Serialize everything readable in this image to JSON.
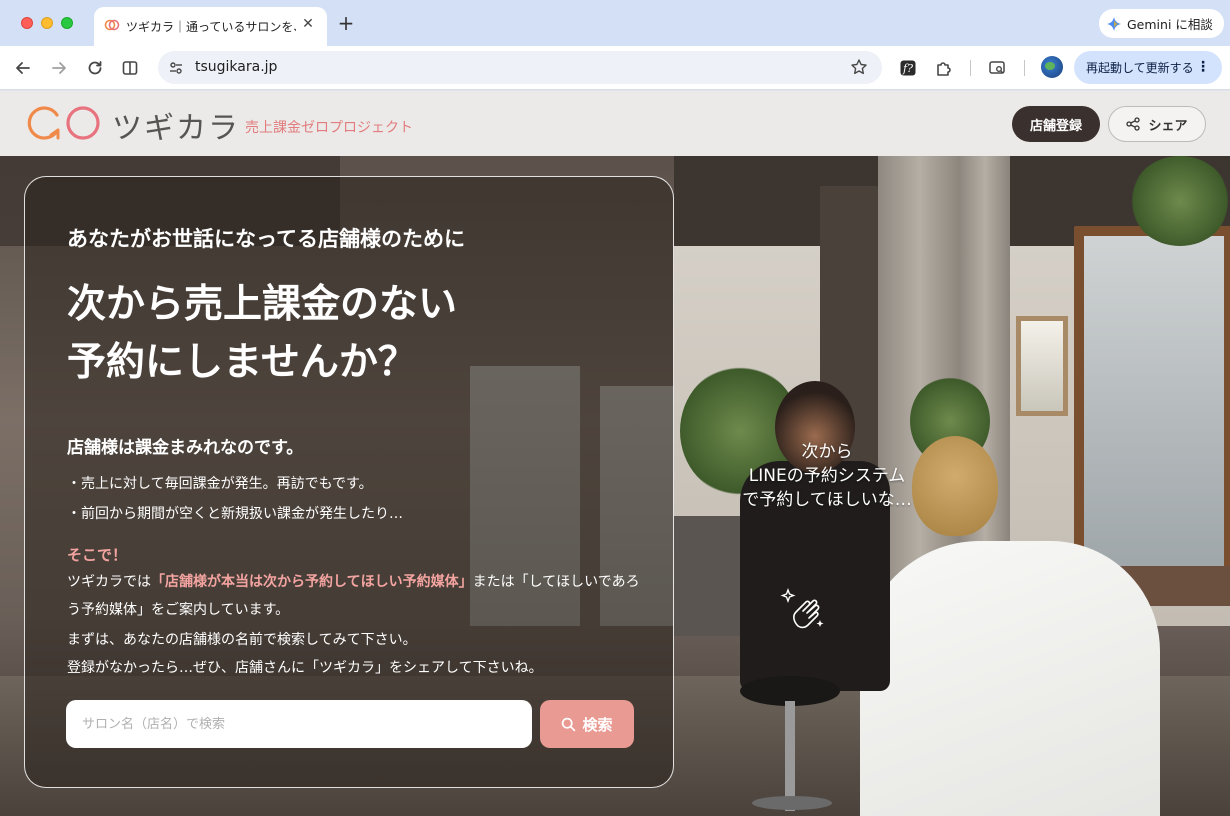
{
  "browser": {
    "tab_title": "ツギカラ｜通っているサロンを、",
    "tab_close": "✕",
    "new_tab": "+",
    "gemini_label": "Gemini に相談",
    "url": "tsugikara.jp",
    "restart_label": "再起動して更新する",
    "menu_dots": "⋮"
  },
  "header": {
    "logo_text": "ツギカラ",
    "logo_sub": "売上課金ゼロプロジェクト",
    "register_label": "店舗登録",
    "share_label": "シェア"
  },
  "hero": {
    "lead": "あなたがお世話になってる店舗様のために",
    "headline_line1": "次から売上課金のない",
    "headline_line2": "予約にしませんか？",
    "subhead": "店舗様は課金まみれなのです。",
    "bullet1": "・売上に対して毎回課金が発生。再訪でもです。",
    "bullet2": "・前回から期間が空くと新規扱い課金が発生したり…",
    "soko": "そこで！",
    "para1_a": "ツギカラでは",
    "para1_hl": "「店舗様が本当は次から予約してほしい予約媒体」",
    "para1_b": "または「してほしいであろう予約媒体」をご案内しています。",
    "para2_line1": "まずは、あなたの店舗様の名前で検索してみて下さい。",
    "para2_line2": "登録がなかったら…ぜひ、店舗さんに「ツギカラ」をシェアして下さいね。",
    "search_placeholder": "サロン名（店名）で検索",
    "search_value": "",
    "search_button": "検索",
    "bubble_line1": "次から",
    "bubble_line2": "LINEの予約システム",
    "bubble_line3": "で予約してほしいな…"
  },
  "colors": {
    "accent_pink": "#e99a92",
    "highlight_pink": "#f4a4a0",
    "dark_button": "#3a302e",
    "logo_orange": "#f08a4b",
    "logo_pink": "#e8737f"
  },
  "icons": {
    "back": "arrow-left-icon",
    "forward": "arrow-right-icon",
    "reload": "reload-icon",
    "split": "split-view-icon",
    "site_info": "tune-icon",
    "bookmark": "star-icon",
    "extension_f": "font-extension-icon",
    "extensions": "puzzle-icon",
    "tab_search": "tab-search-icon",
    "share": "share-icon",
    "search": "search-icon"
  }
}
